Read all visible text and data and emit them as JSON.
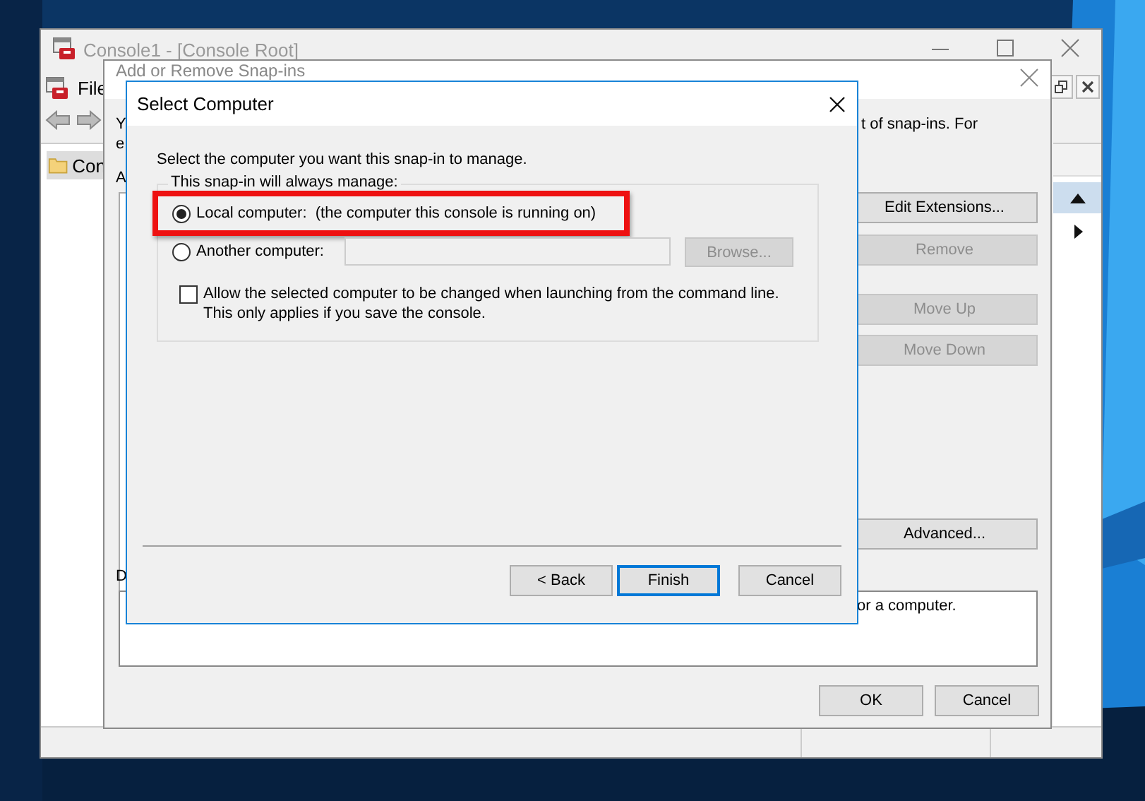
{
  "console_window": {
    "title": "Console1 - [Console Root]",
    "menu": [
      "File"
    ],
    "tree": [
      {
        "label": "Con",
        "selected": true
      }
    ]
  },
  "snapins_dialog": {
    "title": "Add or Remove Snap-ins",
    "intro_fragments": [
      "Y",
      "e"
    ],
    "intro_right_fragment": "t of snap-ins. For",
    "available_label": "A",
    "description_label": "D",
    "description_fragment": "or a computer.",
    "side_buttons": [
      {
        "label": "Edit Extensions...",
        "disabled": false
      },
      {
        "label": "Remove",
        "disabled": true
      },
      {
        "label": "Move Up",
        "disabled": true
      },
      {
        "label": "Move Down",
        "disabled": true
      },
      {
        "label": "Advanced...",
        "disabled": false
      }
    ],
    "buttons": [
      "OK",
      "Cancel"
    ]
  },
  "select_computer": {
    "title": "Select Computer",
    "prompt": "Select the computer you want this snap-in to manage.",
    "group_label": "This snap-in will always manage:",
    "options": [
      {
        "label": "Local computer:  (the computer this console is running on)",
        "selected": true,
        "highlighted": true
      },
      {
        "label": "Another computer:",
        "selected": false,
        "highlighted": false
      }
    ],
    "computer_field": {
      "disabled": true
    },
    "browse": {
      "label": "Browse...",
      "disabled": true
    },
    "allow_change": {
      "label": "Allow the selected computer to be changed when launching from the command line.  This only applies if you save the console.",
      "checked": false
    },
    "buttons": [
      {
        "label": "< Back",
        "default": false
      },
      {
        "label": "Finish",
        "default": true
      },
      {
        "label": "Cancel",
        "default": false
      }
    ]
  }
}
